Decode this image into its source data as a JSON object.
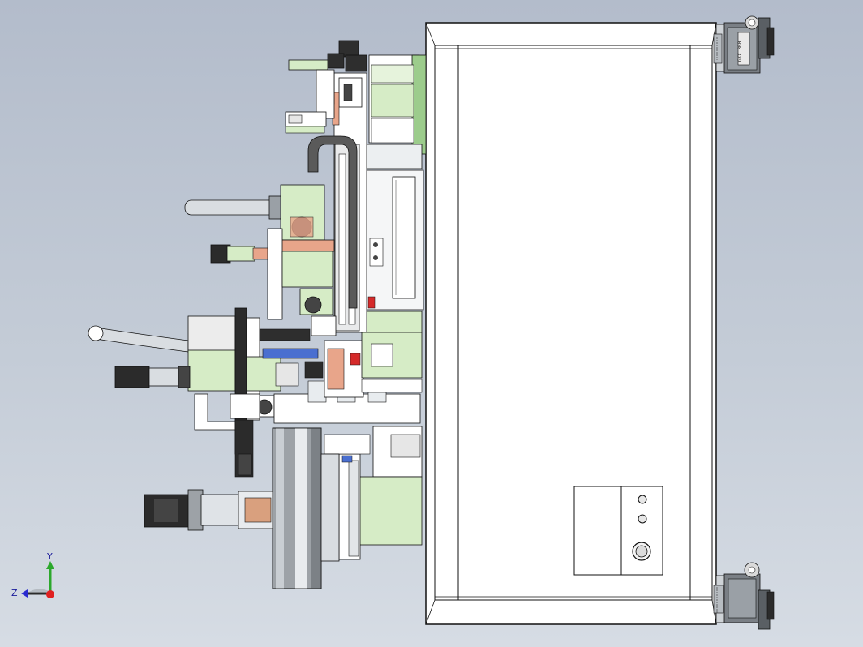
{
  "viewport": {
    "background_top": "#b3bccb",
    "background_bottom": "#d6dce4"
  },
  "triad": {
    "y_label": "Y",
    "z_label": "Z",
    "y_color": "#2ca82c",
    "z_color": "#2b2bd0",
    "x_dot_color": "#e02020"
  },
  "caster": {
    "label": "GKX 360"
  },
  "colors": {
    "cabinet_fill": "#ffffff",
    "line": "#111111",
    "plate_green": "#d6ecc6",
    "bright_green": "#9ccc8c",
    "copper": "#e8a58a",
    "steel": "#c8cdd2",
    "dark": "#3a3a3a",
    "blue": "#4a6fd0",
    "red": "#d52a2a"
  }
}
